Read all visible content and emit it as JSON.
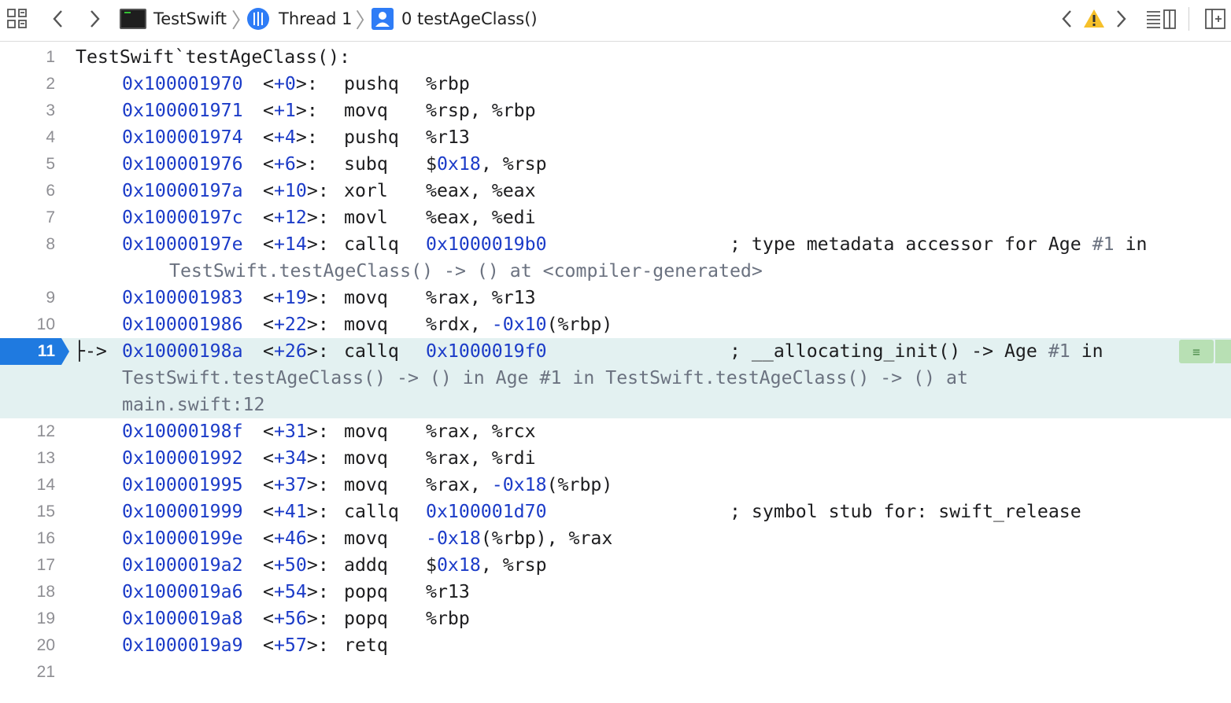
{
  "jumpbar": {
    "project": "TestSwift",
    "thread": "Thread 1",
    "frame": "0 testAgeClass()",
    "icons": [
      "related-items-icon",
      "back-icon",
      "forward-icon",
      "terminal-app-icon",
      "thread-icon",
      "frame-user-icon",
      "prev-issue-icon",
      "warning-icon",
      "next-issue-icon",
      "editor-options-icon",
      "add-editor-icon"
    ]
  },
  "header_line": {
    "num": "1",
    "text": "TestSwift`testAgeClass():"
  },
  "current_line": 11,
  "pc_marker": "├->",
  "instructions": [
    {
      "num": "2",
      "addr": "0x100001970",
      "off": "<+0>:",
      "op": "pushq",
      "args": "%rbp"
    },
    {
      "num": "3",
      "addr": "0x100001971",
      "off": "<+1>:",
      "op": "movq",
      "args": "%rsp, %rbp"
    },
    {
      "num": "4",
      "addr": "0x100001974",
      "off": "<+4>:",
      "op": "pushq",
      "args": "%r13"
    },
    {
      "num": "5",
      "addr": "0x100001976",
      "off": "<+6>:",
      "op": "subq",
      "args": "$0x18, %rsp"
    },
    {
      "num": "6",
      "addr": "0x10000197a",
      "off": "<+10>:",
      "op": "xorl",
      "args": "%eax, %eax"
    },
    {
      "num": "7",
      "addr": "0x10000197c",
      "off": "<+12>:",
      "op": "movl",
      "args": "%eax, %edi"
    },
    {
      "num": "8",
      "addr": "0x10000197e",
      "off": "<+14>:",
      "op": "callq",
      "args": "0x1000019b0",
      "comment": "; type metadata accessor for Age #1 in",
      "comment_cont": [
        "TestSwift.testAgeClass() -> () at <compiler-generated>"
      ]
    },
    {
      "num": "9",
      "addr": "0x100001983",
      "off": "<+19>:",
      "op": "movq",
      "args": "%rax, %r13"
    },
    {
      "num": "10",
      "addr": "0x100001986",
      "off": "<+22>:",
      "op": "movq",
      "args": "%rdx, -0x10(%rbp)"
    },
    {
      "num": "11",
      "addr": "0x10000198a",
      "off": "<+26>:",
      "op": "callq",
      "args": "0x1000019f0",
      "comment": "; __allocating_init() -> Age #1 in",
      "comment_cont": [
        "TestSwift.testAgeClass() -> () in Age #1 in TestSwift.testAgeClass() -> () at",
        "main.swift:12"
      ]
    },
    {
      "num": "12",
      "addr": "0x10000198f",
      "off": "<+31>:",
      "op": "movq",
      "args": "%rax, %rcx"
    },
    {
      "num": "13",
      "addr": "0x100001992",
      "off": "<+34>:",
      "op": "movq",
      "args": "%rax, %rdi"
    },
    {
      "num": "14",
      "addr": "0x100001995",
      "off": "<+37>:",
      "op": "movq",
      "args": "%rax, -0x18(%rbp)"
    },
    {
      "num": "15",
      "addr": "0x100001999",
      "off": "<+41>:",
      "op": "callq",
      "args": "0x100001d70",
      "comment": "; symbol stub for: swift_release"
    },
    {
      "num": "16",
      "addr": "0x10000199e",
      "off": "<+46>:",
      "op": "movq",
      "args": "-0x18(%rbp), %rax"
    },
    {
      "num": "17",
      "addr": "0x1000019a2",
      "off": "<+50>:",
      "op": "addq",
      "args": "$0x18, %rsp"
    },
    {
      "num": "18",
      "addr": "0x1000019a6",
      "off": "<+54>:",
      "op": "popq",
      "args": "%r13"
    },
    {
      "num": "19",
      "addr": "0x1000019a8",
      "off": "<+56>:",
      "op": "popq",
      "args": "%rbp"
    },
    {
      "num": "20",
      "addr": "0x1000019a9",
      "off": "<+57>:",
      "op": "retq",
      "args": ""
    }
  ],
  "trailing_line": {
    "num": "21"
  },
  "colors": {
    "current_line_bg": "#e3f1f1",
    "pc_badge": "#1f7ae0",
    "address_blue": "#1b3bc8",
    "side_button": "#b8e0b4"
  }
}
